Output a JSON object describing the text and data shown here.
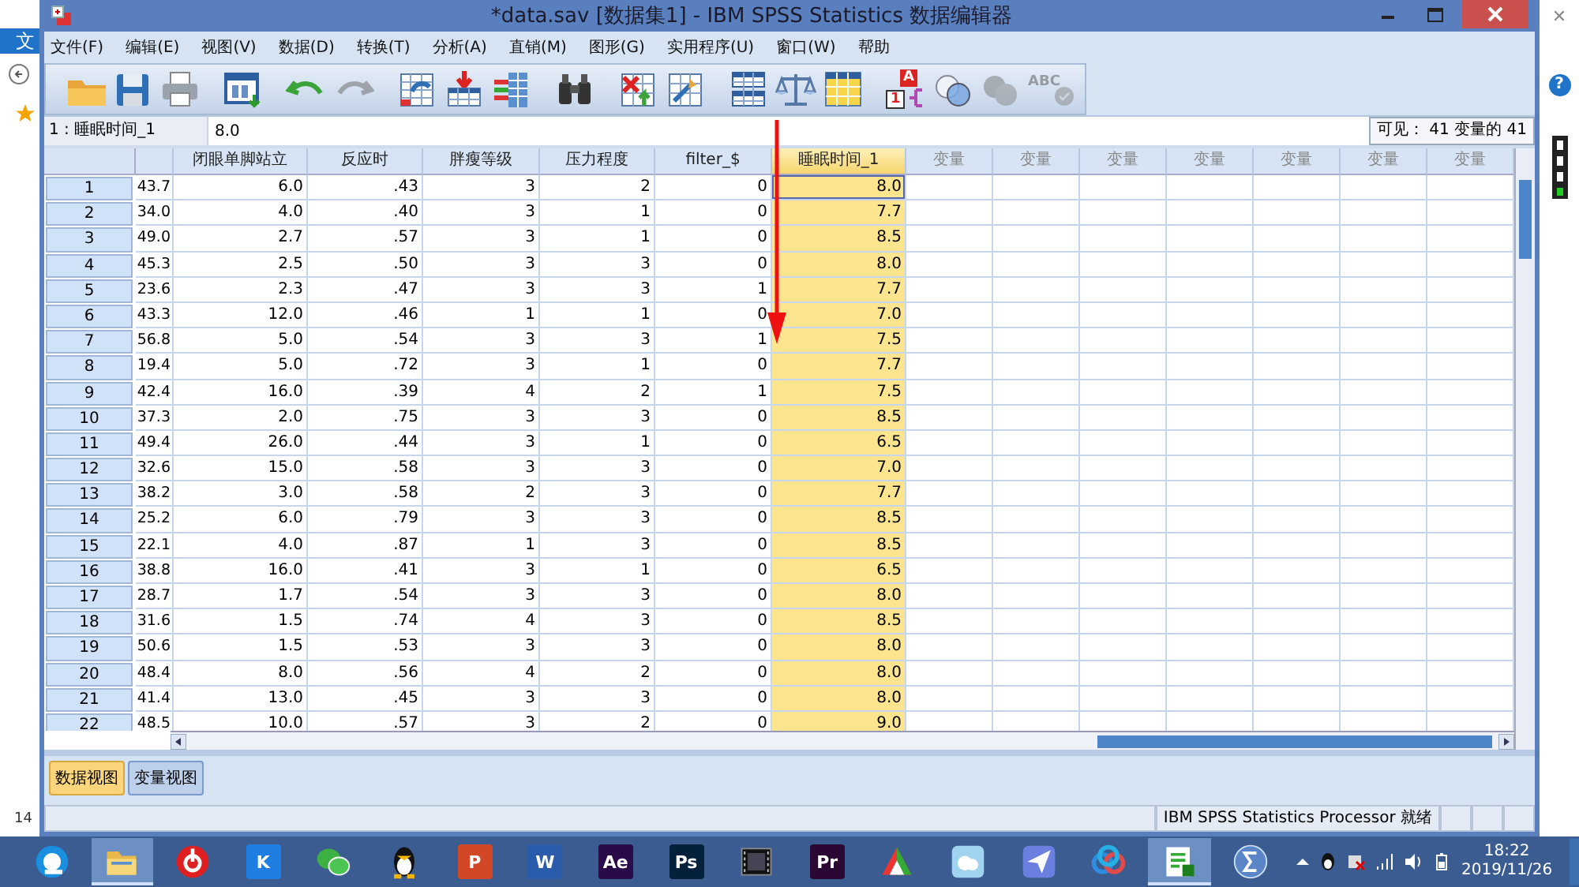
{
  "desktop": {
    "left_fragment": "文",
    "bottom_fragment": "14",
    "close_glyph": "✕",
    "help_glyph": "?"
  },
  "window": {
    "title": "*data.sav [数据集1] - IBM SPSS Statistics 数据编辑器"
  },
  "menu": [
    "文件(F)",
    "编辑(E)",
    "视图(V)",
    "数据(D)",
    "转换(T)",
    "分析(A)",
    "直销(M)",
    "图形(G)",
    "实用程序(U)",
    "窗口(W)",
    "帮助"
  ],
  "toolbar": [
    [
      {
        "kind": "folder",
        "disabled": false
      },
      {
        "kind": "save",
        "disabled": false
      },
      {
        "kind": "print",
        "disabled": false
      }
    ],
    [
      {
        "kind": "recall",
        "disabled": false
      }
    ],
    [
      {
        "kind": "undo",
        "disabled": false
      },
      {
        "kind": "redo",
        "disabled": true
      }
    ],
    [
      {
        "kind": "goto-case",
        "disabled": false
      },
      {
        "kind": "goto-var",
        "disabled": false
      },
      {
        "kind": "variables",
        "disabled": false
      }
    ],
    [
      {
        "kind": "find",
        "disabled": false
      }
    ],
    [
      {
        "kind": "insert-case",
        "disabled": false
      },
      {
        "kind": "insert-var",
        "disabled": false
      }
    ],
    [
      {
        "kind": "split",
        "disabled": false
      },
      {
        "kind": "weight",
        "disabled": false
      },
      {
        "kind": "select",
        "disabled": false
      }
    ],
    [
      {
        "kind": "labels",
        "disabled": false,
        "glyphs": [
          "A",
          "1"
        ]
      },
      {
        "kind": "sets",
        "disabled": false
      },
      {
        "kind": "sets",
        "disabled": true
      },
      {
        "kind": "spell",
        "disabled": true,
        "glyphs": [
          "ABC"
        ]
      }
    ]
  ],
  "cell_editor": {
    "cell_ref": "1 : 睡眠时间_1",
    "value": "8.0",
    "visible_count": "可见： 41 变量的 41"
  },
  "grid": {
    "columns": [
      {
        "kind": "partial",
        "selected": false
      },
      {
        "kind": "data",
        "label": "闭眼单脚站立",
        "selected": false
      },
      {
        "kind": "data",
        "label": "反应时",
        "selected": false
      },
      {
        "kind": "data",
        "label": "胖瘦等级",
        "selected": false
      },
      {
        "kind": "data",
        "label": "压力程度",
        "selected": false
      },
      {
        "kind": "data",
        "label": "filter_$",
        "selected": false
      },
      {
        "kind": "data",
        "label": "睡眠时间_1",
        "selected": true
      },
      {
        "kind": "empty",
        "label": "变量",
        "selected": false
      },
      {
        "kind": "empty",
        "label": "变量",
        "selected": false
      },
      {
        "kind": "empty",
        "label": "变量",
        "selected": false
      },
      {
        "kind": "empty",
        "label": "变量",
        "selected": false
      },
      {
        "kind": "empty",
        "label": "变量",
        "selected": false
      },
      {
        "kind": "empty",
        "label": "变量",
        "selected": false
      },
      {
        "kind": "empty",
        "label": "变量",
        "selected": false
      }
    ],
    "rows": [
      {
        "label": "1",
        "current": true,
        "cells": [
          "43.7",
          "6.0",
          ".43",
          "3",
          "2",
          "0",
          "8.0"
        ]
      },
      {
        "label": "2",
        "current": false,
        "cells": [
          "34.0",
          "4.0",
          ".40",
          "3",
          "1",
          "0",
          "7.7"
        ]
      },
      {
        "label": "3",
        "current": false,
        "cells": [
          "49.0",
          "2.7",
          ".57",
          "3",
          "1",
          "0",
          "8.5"
        ]
      },
      {
        "label": "4",
        "current": false,
        "cells": [
          "45.3",
          "2.5",
          ".50",
          "3",
          "3",
          "0",
          "8.0"
        ]
      },
      {
        "label": "5",
        "current": false,
        "cells": [
          "23.6",
          "2.3",
          ".47",
          "3",
          "3",
          "1",
          "7.7"
        ]
      },
      {
        "label": "6",
        "current": false,
        "cells": [
          "43.3",
          "12.0",
          ".46",
          "1",
          "1",
          "0",
          "7.0"
        ]
      },
      {
        "label": "7",
        "current": false,
        "cells": [
          "56.8",
          "5.0",
          ".54",
          "3",
          "3",
          "1",
          "7.5"
        ]
      },
      {
        "label": "8",
        "current": false,
        "cells": [
          "19.4",
          "5.0",
          ".72",
          "3",
          "1",
          "0",
          "7.7"
        ]
      },
      {
        "label": "9",
        "current": false,
        "cells": [
          "42.4",
          "16.0",
          ".39",
          "4",
          "2",
          "1",
          "7.5"
        ]
      },
      {
        "label": "10",
        "current": false,
        "cells": [
          "37.3",
          "2.0",
          ".75",
          "3",
          "3",
          "0",
          "8.5"
        ]
      },
      {
        "label": "11",
        "current": false,
        "cells": [
          "49.4",
          "26.0",
          ".44",
          "3",
          "1",
          "0",
          "6.5"
        ]
      },
      {
        "label": "12",
        "current": false,
        "cells": [
          "32.6",
          "15.0",
          ".58",
          "3",
          "3",
          "0",
          "7.0"
        ]
      },
      {
        "label": "13",
        "current": false,
        "cells": [
          "38.2",
          "3.0",
          ".58",
          "2",
          "3",
          "0",
          "7.7"
        ]
      },
      {
        "label": "14",
        "current": false,
        "cells": [
          "25.2",
          "6.0",
          ".79",
          "3",
          "3",
          "0",
          "8.5"
        ]
      },
      {
        "label": "15",
        "current": false,
        "cells": [
          "22.1",
          "4.0",
          ".87",
          "1",
          "3",
          "0",
          "8.5"
        ]
      },
      {
        "label": "16",
        "current": false,
        "cells": [
          "38.8",
          "16.0",
          ".41",
          "3",
          "1",
          "0",
          "6.5"
        ]
      },
      {
        "label": "17",
        "current": false,
        "cells": [
          "28.7",
          "1.7",
          ".54",
          "3",
          "3",
          "0",
          "8.0"
        ]
      },
      {
        "label": "18",
        "current": false,
        "cells": [
          "31.6",
          "1.5",
          ".74",
          "4",
          "3",
          "0",
          "8.5"
        ]
      },
      {
        "label": "19",
        "current": false,
        "cells": [
          "50.6",
          "1.5",
          ".53",
          "3",
          "3",
          "0",
          "8.0"
        ]
      },
      {
        "label": "20",
        "current": false,
        "cells": [
          "48.4",
          "8.0",
          ".56",
          "4",
          "2",
          "0",
          "8.0"
        ]
      },
      {
        "label": "21",
        "current": false,
        "cells": [
          "41.4",
          "13.0",
          ".45",
          "3",
          "3",
          "0",
          "8.0"
        ]
      },
      {
        "label": "22",
        "current": false,
        "cells": [
          "48.5",
          "10.0",
          ".57",
          "3",
          "2",
          "0",
          "9.0"
        ]
      }
    ]
  },
  "view_tabs": [
    {
      "label": "数据视图",
      "selected": true
    },
    {
      "label": "变量视图",
      "selected": false
    }
  ],
  "status_bar": {
    "text": "IBM SPSS Statistics Processor 就绪"
  },
  "taskbar": {
    "items": [
      {
        "kind": "browser",
        "selected": false
      },
      {
        "kind": "folder",
        "selected": true
      },
      {
        "kind": "music",
        "selected": false
      },
      {
        "kind": "logo",
        "glyph": "K",
        "color": "#1e7fe0",
        "selected": false
      },
      {
        "kind": "chat",
        "selected": false
      },
      {
        "kind": "penguin",
        "selected": false
      },
      {
        "kind": "logo",
        "glyph": "P",
        "color": "#d24726",
        "selected": false
      },
      {
        "kind": "logo",
        "glyph": "W",
        "color": "#2b5cab",
        "selected": false
      },
      {
        "kind": "logo",
        "glyph": "Ae",
        "color": "#2a0b4a",
        "selected": false
      },
      {
        "kind": "logo",
        "glyph": "Ps",
        "color": "#04203a",
        "selected": false
      },
      {
        "kind": "film",
        "selected": false
      },
      {
        "kind": "logo",
        "glyph": "Pr",
        "color": "#2a0833",
        "selected": false
      },
      {
        "kind": "paint",
        "selected": false
      },
      {
        "kind": "cloud",
        "selected": false
      },
      {
        "kind": "plane",
        "selected": false
      },
      {
        "kind": "netdisk",
        "selected": false
      },
      {
        "kind": "sheet",
        "selected": true
      },
      {
        "kind": "sigma",
        "selected": false
      }
    ],
    "time": "18:22",
    "date": "2019/11/26"
  }
}
